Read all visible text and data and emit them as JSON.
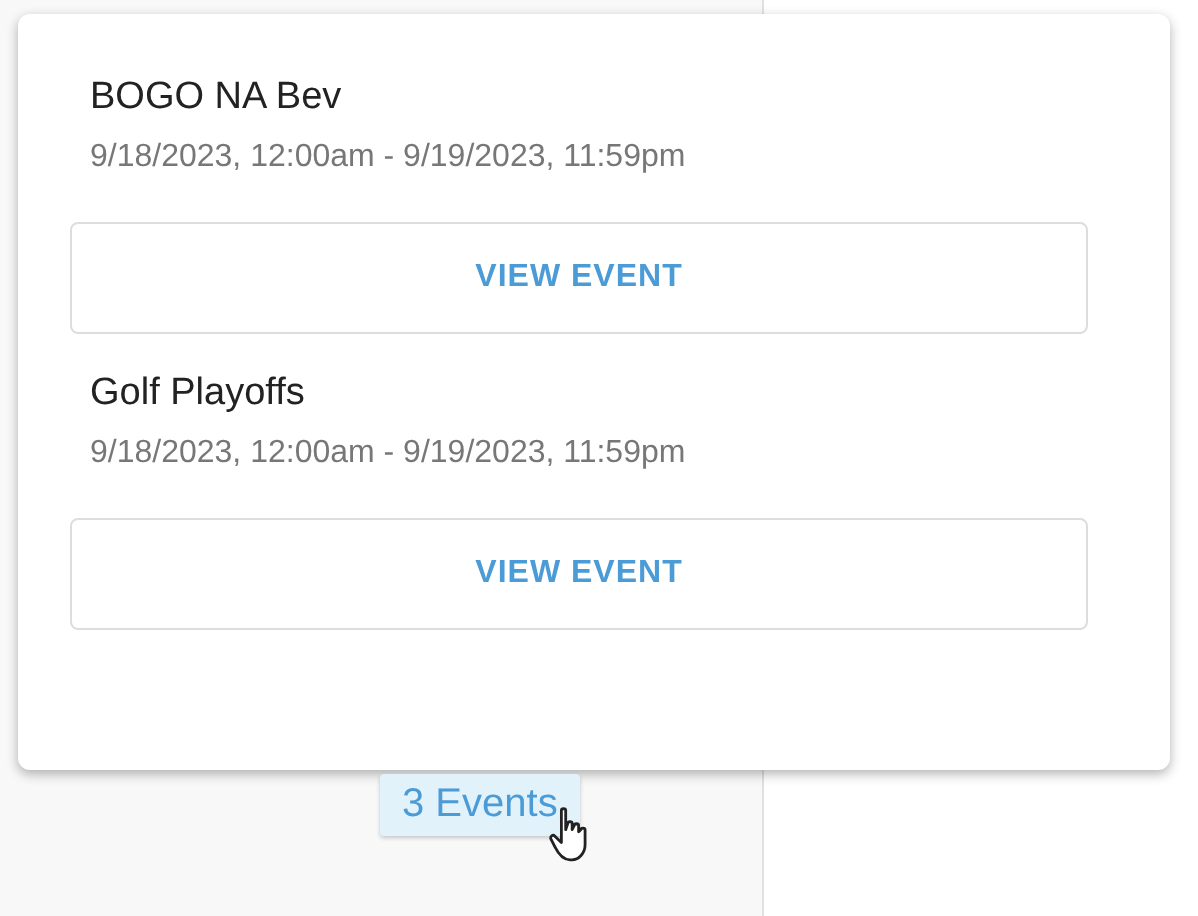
{
  "popover": {
    "events": [
      {
        "title": "BOGO NA Bev",
        "time_range": "9/18/2023, 12:00am - 9/19/2023, 11:59pm",
        "button": "VIEW EVENT"
      },
      {
        "title": "Golf Playoffs",
        "time_range": "9/18/2023, 12:00am - 9/19/2023, 11:59pm",
        "button": "VIEW EVENT"
      }
    ]
  },
  "events_chip": {
    "label": "3 Events"
  }
}
